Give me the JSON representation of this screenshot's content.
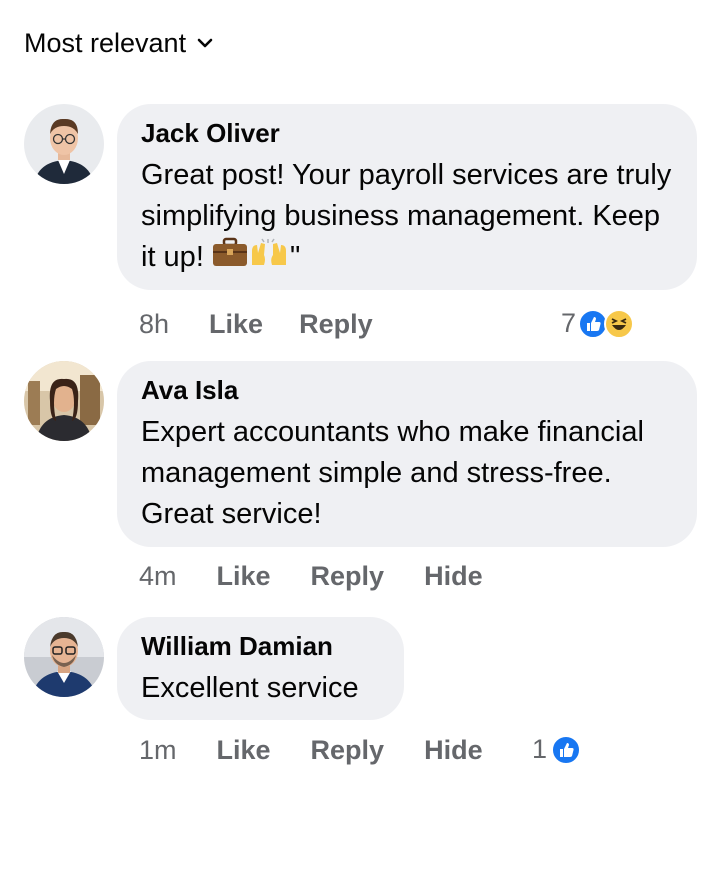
{
  "sort": {
    "label": "Most relevant",
    "icon": "chevron-down-icon"
  },
  "comments": [
    {
      "author": "Jack Oliver",
      "text": "Great post! Your payroll services are truly simplifying business management. Keep it up!",
      "text_suffix": "\"",
      "inline_emojis": [
        "briefcase-emoji",
        "raising-hands-emoji"
      ],
      "time": "8h",
      "like_label": "Like",
      "reply_label": "Reply",
      "reaction_count": "7",
      "reaction_icons": [
        "like-reaction-icon",
        "haha-reaction-icon"
      ]
    },
    {
      "author": "Ava Isla",
      "text": "Expert accountants who make financial management simple and stress-free. Great service!",
      "time": "4m",
      "like_label": "Like",
      "reply_label": "Reply",
      "hide_label": "Hide"
    },
    {
      "author": "William Damian",
      "text": "Excellent service",
      "time": "1m",
      "like_label": "Like",
      "reply_label": "Reply",
      "hide_label": "Hide",
      "reaction_count": "1",
      "reaction_icons": [
        "like-reaction-icon"
      ]
    }
  ],
  "colors": {
    "bubble": "#eff0f3",
    "secondary_text": "#65676b",
    "like_blue": "#1877f2",
    "haha_yellow": "#f7c84a"
  }
}
